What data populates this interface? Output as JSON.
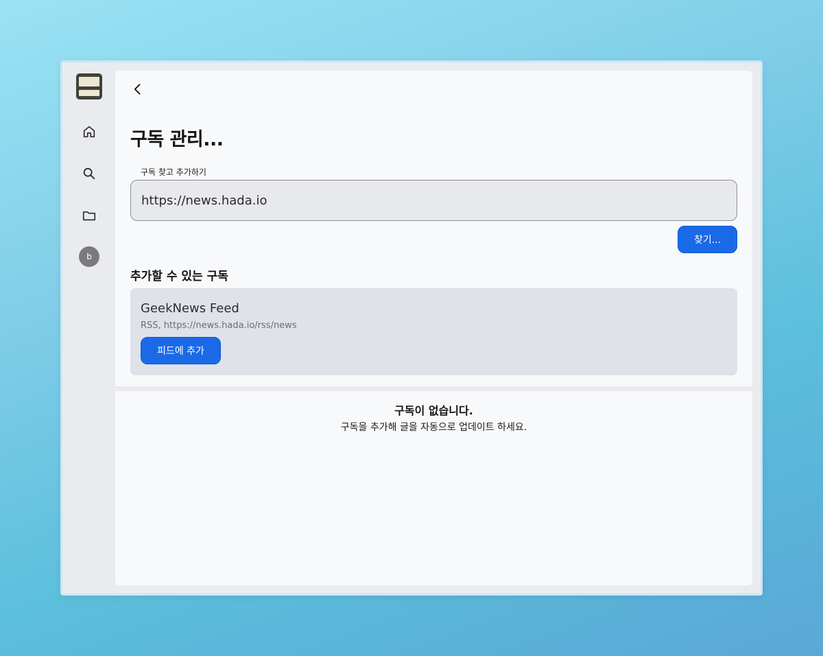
{
  "sidebar": {
    "logo": "app-logo",
    "items": [
      {
        "name": "home",
        "icon": "home-icon"
      },
      {
        "name": "search",
        "icon": "search-icon"
      },
      {
        "name": "folder",
        "icon": "folder-icon"
      }
    ],
    "avatar_initial": "b"
  },
  "header": {
    "back_icon": "chevron-left-icon",
    "title": "구독 관리..."
  },
  "search": {
    "label": "구독 찾고 추가하기",
    "value": "https://news.hada.io",
    "button_label": "찾기..."
  },
  "available": {
    "title": "추가할 수 있는 구독",
    "feeds": [
      {
        "name": "GeekNews Feed",
        "meta": "RSS, https://news.hada.io/rss/news",
        "button_label": "피드에 추가"
      }
    ]
  },
  "empty_state": {
    "title": "구독이 없습니다.",
    "description": "구독을 추가해 글을 자동으로 업데이트 하세요."
  },
  "colors": {
    "accent": "#1a6ae8",
    "card": "#dfe2e8",
    "panel": "#f8f9fb",
    "window": "#e9ebef"
  }
}
